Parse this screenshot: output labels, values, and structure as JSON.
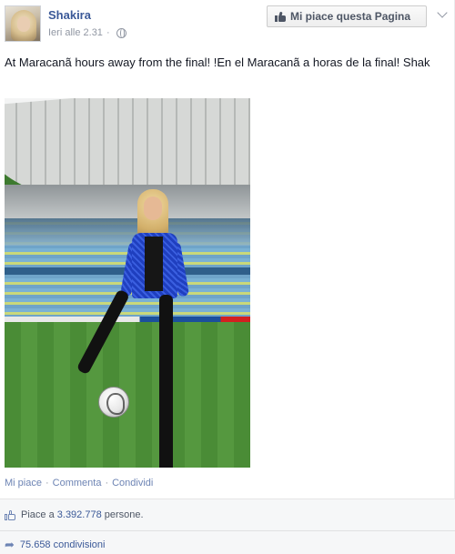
{
  "header": {
    "page_name": "Shakira",
    "timestamp": "Ieri alle 2.31",
    "separator": "·",
    "like_page_label": "Mi piace questa Pagina"
  },
  "post": {
    "text": "At Maracanã hours away from the final! !En el Maracanã a horas de la final! Shak"
  },
  "actions": {
    "like": "Mi piace",
    "comment": "Commenta",
    "share": "Condividi",
    "separator": "·"
  },
  "stats": {
    "likes_prefix": "Piace a",
    "likes_count": "3.392.778",
    "likes_suffix": "persone.",
    "shares_count": "75.658",
    "shares_label": "condivisioni"
  },
  "icons": {
    "globe": "globe-icon",
    "like_page": "thumbs-up-icon",
    "menu": "chevron-down-icon",
    "likes": "thumbs-up-outline-icon",
    "shares": "share-arrow-icon"
  },
  "colors": {
    "link": "#3b5998",
    "muted": "#9197a3",
    "action_link": "#6d84b4",
    "footer_bg": "#f6f7f8"
  }
}
